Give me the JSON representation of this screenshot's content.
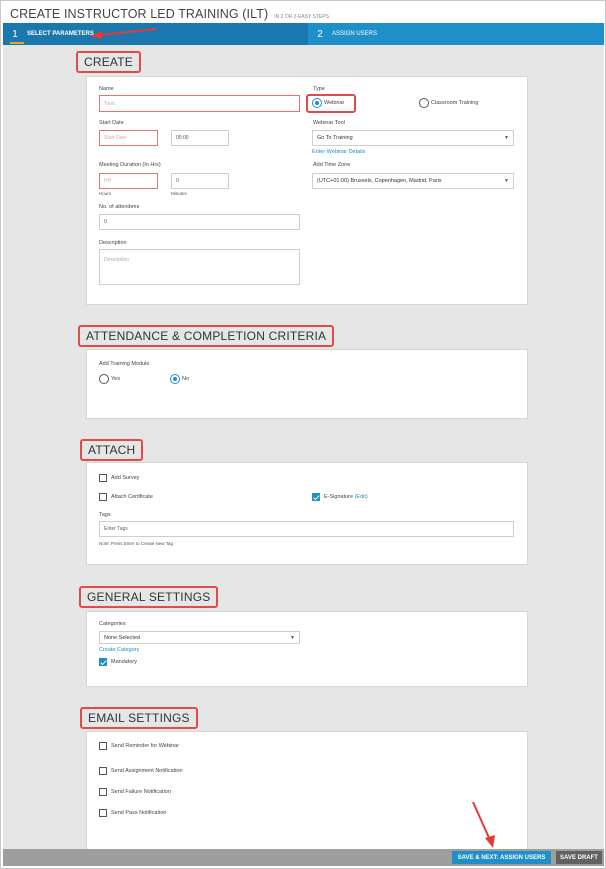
{
  "header": {
    "title": "CREATE INSTRUCTOR LED TRAINING (ILT)",
    "subtitle": "IN 2 OR 3 EASY STEPS"
  },
  "steps": [
    {
      "num": "1",
      "label": "SELECT PARAMETERS"
    },
    {
      "num": "2",
      "label": "ASSIGN USERS"
    }
  ],
  "create": {
    "title": "CREATE",
    "name_label": "Name",
    "name_placeholder": "Topic",
    "type_label": "Type",
    "type_options": [
      "Webinar",
      "Classroom Training"
    ],
    "type_selected": "Webinar",
    "start_date_label": "Start Date",
    "start_date_placeholder": "Start Date",
    "start_time": "00:00",
    "webinar_tool_label": "Webinar Tool",
    "webinar_tool_value": "Go To Training",
    "webinar_details_link": "Enter Webinar Details",
    "duration_label": "Meeting Duration (In Hrs)",
    "hours_placeholder": "HH",
    "minutes_value": "0",
    "hours_caption": "Hours",
    "minutes_caption": "Minutes",
    "time_zone_label": "Add Time Zone",
    "time_zone_value": "(UTC+01:00) Brussels, Copenhagen, Madrid, Paris",
    "attendees_label": "No. of attendees",
    "attendees_value": "0",
    "description_label": "Description",
    "description_placeholder": "Description"
  },
  "attendance": {
    "title": "ATTENDANCE & COMPLETION CRITERIA",
    "module_label": "Add Training Module",
    "options": [
      "Yes",
      "No"
    ],
    "selected": "No"
  },
  "attach": {
    "title": "ATTACH",
    "add_survey": "Add Survey",
    "add_survey_checked": false,
    "attach_certificate": "Attach Certificate",
    "attach_certificate_checked": false,
    "esignature": "E-Signature",
    "esignature_edit": "(Edit)",
    "esignature_checked": true,
    "tags_label": "Tags",
    "tags_placeholder": "Enter Tags",
    "tags_note": "Note: Press Enter to Create New Tag"
  },
  "general": {
    "title": "GENERAL SETTINGS",
    "categories_label": "Categories",
    "categories_value": "None Selected",
    "create_category_link": "Create Category",
    "mandatory": "Mandatory",
    "mandatory_checked": true
  },
  "email": {
    "title": "EMAIL SETTINGS",
    "items": [
      "Send Reminder for Webinar",
      "Send Assignment Notification",
      "Send Failure Notification",
      "Send Pass Notification"
    ]
  },
  "footer": {
    "save_next": "SAVE & NEXT: ASSIGN USERS",
    "save_draft": "SAVE DRAFT"
  },
  "colors": {
    "primary": "#1f8fc9",
    "step_active": "#1b78ad",
    "highlight": "#e34a4a",
    "panel": "#e6e6e6"
  }
}
